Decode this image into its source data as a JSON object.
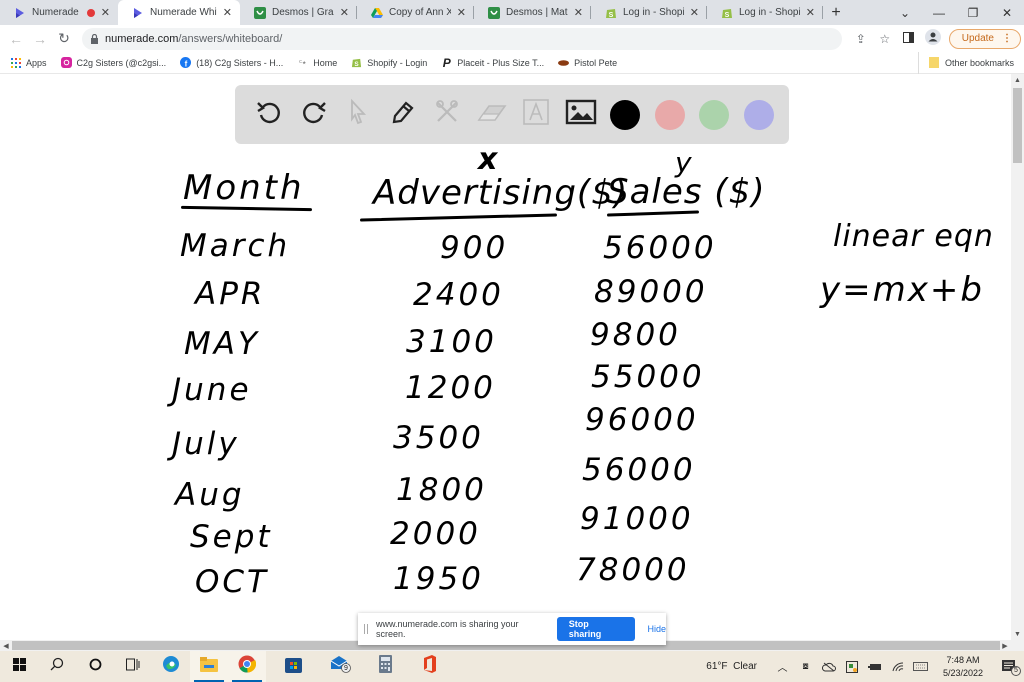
{
  "browser": {
    "tabs": [
      {
        "title": "Numerade",
        "icon": "numerade-icon",
        "recording": true,
        "active": false
      },
      {
        "title": "Numerade White",
        "icon": "numerade-icon",
        "recording": false,
        "active": true
      },
      {
        "title": "Desmos | Graphi",
        "icon": "desmos-icon",
        "recording": false,
        "active": false
      },
      {
        "title": "Copy of Ann Xav",
        "icon": "google-drive-icon",
        "recording": false,
        "active": false
      },
      {
        "title": "Desmos | Matrix",
        "icon": "desmos-icon",
        "recording": false,
        "active": false
      },
      {
        "title": "Log in - Shopify",
        "icon": "shopify-icon",
        "recording": false,
        "active": false
      },
      {
        "title": "Log in - Shopify",
        "icon": "shopify-icon",
        "recording": false,
        "active": false
      }
    ],
    "new_tab": "+",
    "window_controls": {
      "tab_search": "⌄",
      "minimize": "—",
      "restore": "❐",
      "close": "✕"
    },
    "address": {
      "host": "numerade.com",
      "path": "/answers/whiteboard/"
    },
    "update_label": "Update",
    "bookmarks": [
      {
        "label": "Apps",
        "icon": "apps-grid-icon"
      },
      {
        "label": "C2g Sisters (@c2gsi...",
        "icon": "instagram-icon"
      },
      {
        "label": "(18) C2g Sisters - H...",
        "icon": "facebook-icon"
      },
      {
        "label": "Home",
        "icon": "home-site-icon"
      },
      {
        "label": "Shopify - Login",
        "icon": "shopify-icon"
      },
      {
        "label": "Placeit - Plus Size T...",
        "icon": "placeit-icon"
      },
      {
        "label": "Pistol Pete",
        "icon": "pistol-pete-icon"
      }
    ],
    "other_bookmarks": "Other bookmarks"
  },
  "whiteboard": {
    "tools": [
      {
        "name": "undo",
        "enabled": true
      },
      {
        "name": "redo",
        "enabled": true
      },
      {
        "name": "select",
        "enabled": false
      },
      {
        "name": "pen",
        "enabled": true
      },
      {
        "name": "tools",
        "enabled": false
      },
      {
        "name": "eraser",
        "enabled": false
      },
      {
        "name": "text",
        "enabled": false
      },
      {
        "name": "image",
        "enabled": true
      }
    ],
    "colors": [
      "#000000",
      "#e8a9a9",
      "#abd3ab",
      "#aeaee8"
    ],
    "handwriting": {
      "headers": {
        "month": "Month",
        "advertising": "Advertising($)",
        "sales": "Sales ($)"
      },
      "annotations": {
        "x_label": "x",
        "y_label": "y"
      },
      "rows": [
        {
          "month": "March",
          "advertising": "900",
          "sales": "56000"
        },
        {
          "month": "APR",
          "advertising": "2400",
          "sales": "89000"
        },
        {
          "month": "MAY",
          "advertising": "3100",
          "sales": "9800"
        },
        {
          "month": "June",
          "advertising": "1200",
          "sales": "55000"
        },
        {
          "month": "July",
          "advertising": "3500",
          "sales": "96000"
        },
        {
          "month": "Aug",
          "advertising": "1800",
          "sales": "56000"
        },
        {
          "month": "Sept",
          "advertising": "2000",
          "sales": "91000"
        },
        {
          "month": "OCT",
          "advertising": "1950",
          "sales": "78000"
        }
      ],
      "notes": {
        "line1": "linear eqn",
        "line2": "y=mx+b"
      }
    }
  },
  "share_bar": {
    "message": "www.numerade.com is sharing your screen.",
    "stop_label": "Stop sharing",
    "hide_label": "Hide"
  },
  "taskbar": {
    "apps": [
      "start",
      "search",
      "cortana",
      "task-view",
      "edge",
      "file-explorer",
      "chrome",
      "store",
      "mail",
      "calculator",
      "office"
    ],
    "mail_badge": "9",
    "weather": {
      "temp": "61°F",
      "condition": "Clear"
    },
    "clock": {
      "time": "7:48 AM",
      "date": "5/23/2022"
    },
    "notifications_count": "5"
  }
}
